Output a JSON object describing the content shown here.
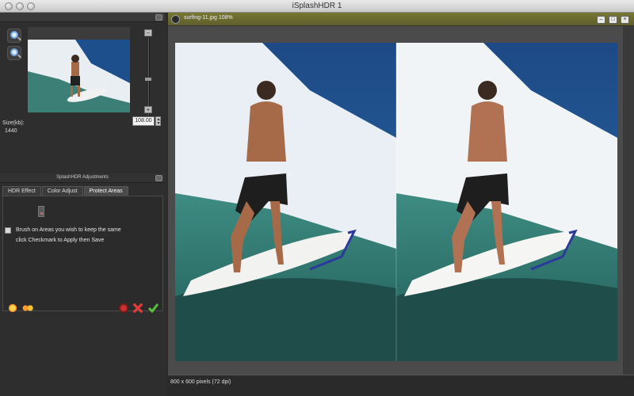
{
  "app": {
    "title": "iSplashHDR 1"
  },
  "sidebar": {
    "size_label": "Size(kb):",
    "size_value": "1440",
    "zoom_value": "108.00",
    "zoom_in_icon": "zoom-in-icon",
    "zoom_out_icon": "zoom-out-icon"
  },
  "adjustments": {
    "panel_title": "SplashHDR Adjustments",
    "tabs": [
      {
        "label": "HDR Effect",
        "active": false
      },
      {
        "label": "Color Adjust",
        "active": false
      },
      {
        "label": "Protect Areas",
        "active": true
      }
    ],
    "instruction_line1": "Brush on Areas you wish to keep the same",
    "instruction_line2": "click Checkmark to Apply then Save"
  },
  "toolbar": {
    "icons": [
      "sun-icon",
      "dots-icon",
      "undo-icon",
      "cancel-icon",
      "apply-checkmark-icon"
    ]
  },
  "document": {
    "title": "surfing-11.jpg 108%",
    "status": "800 x 600 pixels (72 dpi)"
  },
  "colors": {
    "accent_header": "#6b6b2f",
    "apply": "#58c23a",
    "cancel": "#d83a3a"
  }
}
